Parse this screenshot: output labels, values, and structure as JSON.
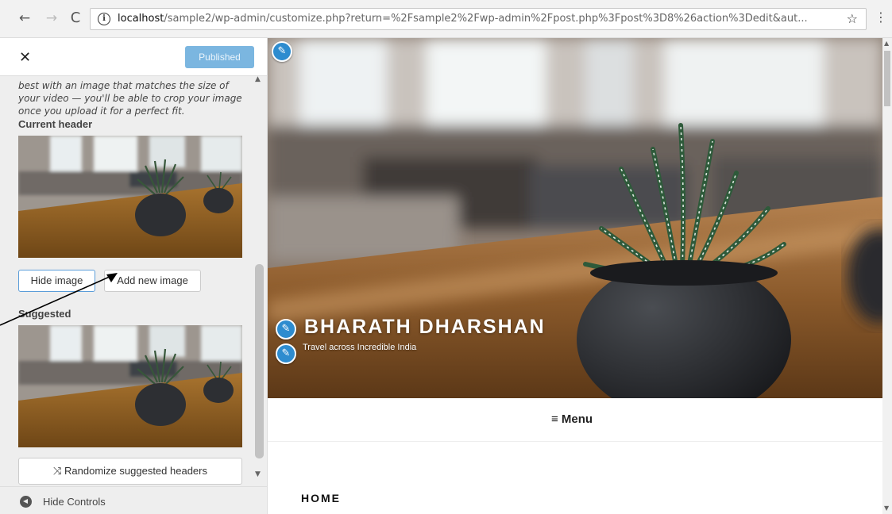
{
  "browser": {
    "url_host": "localhost",
    "url_path": "/sample2/wp-admin/customize.php?return=%2Fsample2%2Fwp-admin%2Fpost.php%3Fpost%3D8%26action%3Dedit&aut...",
    "back_glyph": "←",
    "forward_glyph": "→",
    "reload_glyph": "C",
    "star_glyph": "☆",
    "menu_glyph": "⋮"
  },
  "sidebar": {
    "close_glyph": "✕",
    "publish_button": "Published",
    "description": "best with an image that matches the size of your video — you'll be able to crop your image once you upload it for a perfect fit.",
    "current_header_label": "Current header",
    "hide_image_button": "Hide image",
    "add_new_image_button": "Add new image",
    "suggested_label": "Suggested",
    "randomize_button": "Randomize suggested headers",
    "randomize_glyph": "⤨",
    "hide_controls": "Hide Controls"
  },
  "preview": {
    "site_title": "BHARATH DHARSHAN",
    "tagline": "Travel across Incredible India",
    "menu_label": "≡ Menu",
    "home_label": "HOME"
  },
  "colors": {
    "accent": "#2e8ccf",
    "publish_disabled": "#7bb6e0"
  },
  "icons": {
    "edit_shortcut": "pencil-icon",
    "hide_controls": "collapse-left-icon",
    "randomize": "shuffle-icon",
    "info": "info-icon"
  }
}
